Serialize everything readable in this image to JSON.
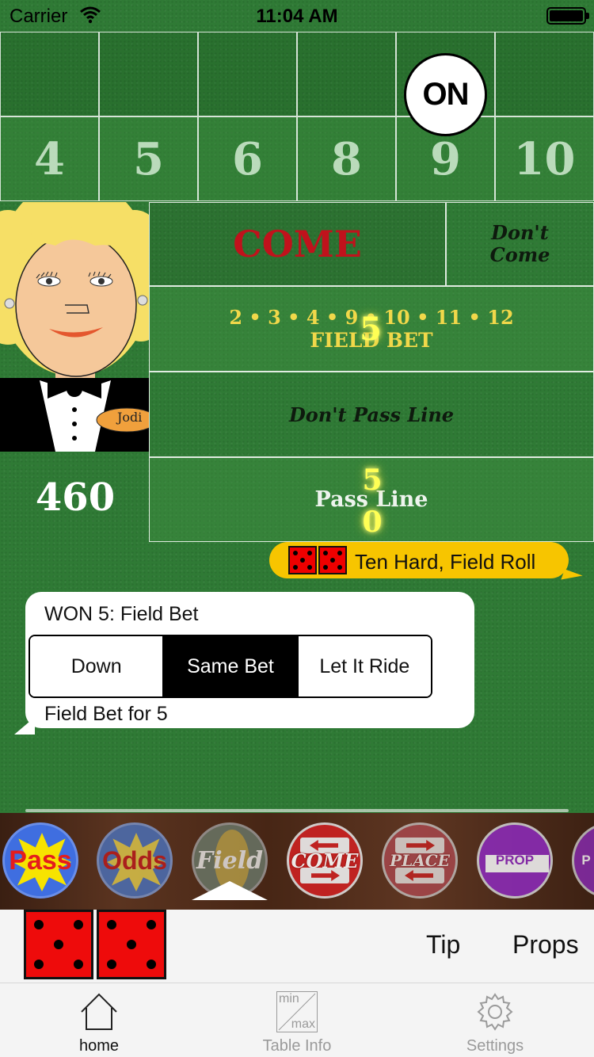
{
  "status_bar": {
    "carrier": "Carrier",
    "time": "11:04 AM"
  },
  "place_numbers": [
    "4",
    "5",
    "6",
    "8",
    "9",
    "10"
  ],
  "puck": {
    "label": "ON",
    "point": "9"
  },
  "table": {
    "come": "COME",
    "dont_come": "Don't Come",
    "field_numbers": "2 • 3 • 4 • 9 • 10 • 11 • 12",
    "field_label": "FIELD BET",
    "dont_pass": "Don't Pass Line",
    "pass_line": "Pass Line"
  },
  "bets": {
    "field": "5",
    "pass_top": "5",
    "pass_bottom": "0"
  },
  "dealer": {
    "name": "Jodi"
  },
  "bankroll": "460",
  "roll_message": {
    "text": "Ten Hard, Field Roll",
    "die1": 5,
    "die2": 5
  },
  "result": {
    "title": "WON 5: Field Bet",
    "options": [
      "Down",
      "Same Bet",
      "Let It Ride"
    ],
    "selected": "Same Bet",
    "footer": "Field Bet for 5"
  },
  "chip_rail": {
    "chips": [
      {
        "label": "Pass",
        "icon": "pass-chip-icon"
      },
      {
        "label": "Odds",
        "icon": "odds-chip-icon"
      },
      {
        "label": "Field",
        "icon": "field-chip-icon"
      },
      {
        "label": "COME",
        "icon": "come-chip-icon"
      },
      {
        "label": "PLACE",
        "icon": "place-chip-icon"
      },
      {
        "label": "PROP",
        "icon": "prop-chip-icon"
      },
      {
        "label": "P",
        "icon": "prop-chip-icon"
      }
    ],
    "selected": "Field"
  },
  "dice": [
    5,
    5
  ],
  "controls": {
    "tip": "Tip",
    "props": "Props"
  },
  "tabs": [
    {
      "label": "home",
      "icon": "home-icon",
      "active": true
    },
    {
      "label": "Table Info",
      "icon": "min-max-icon",
      "active": false,
      "icon_text_top": "min",
      "icon_text_bottom": "max"
    },
    {
      "label": "Settings",
      "icon": "gear-icon",
      "active": false
    }
  ],
  "colors": {
    "felt": "#2f7a35",
    "come_text": "#c0121c",
    "field_text": "#f1d84a",
    "bubble_yellow": "#f7c500",
    "die_red": "#ee0b0b"
  }
}
